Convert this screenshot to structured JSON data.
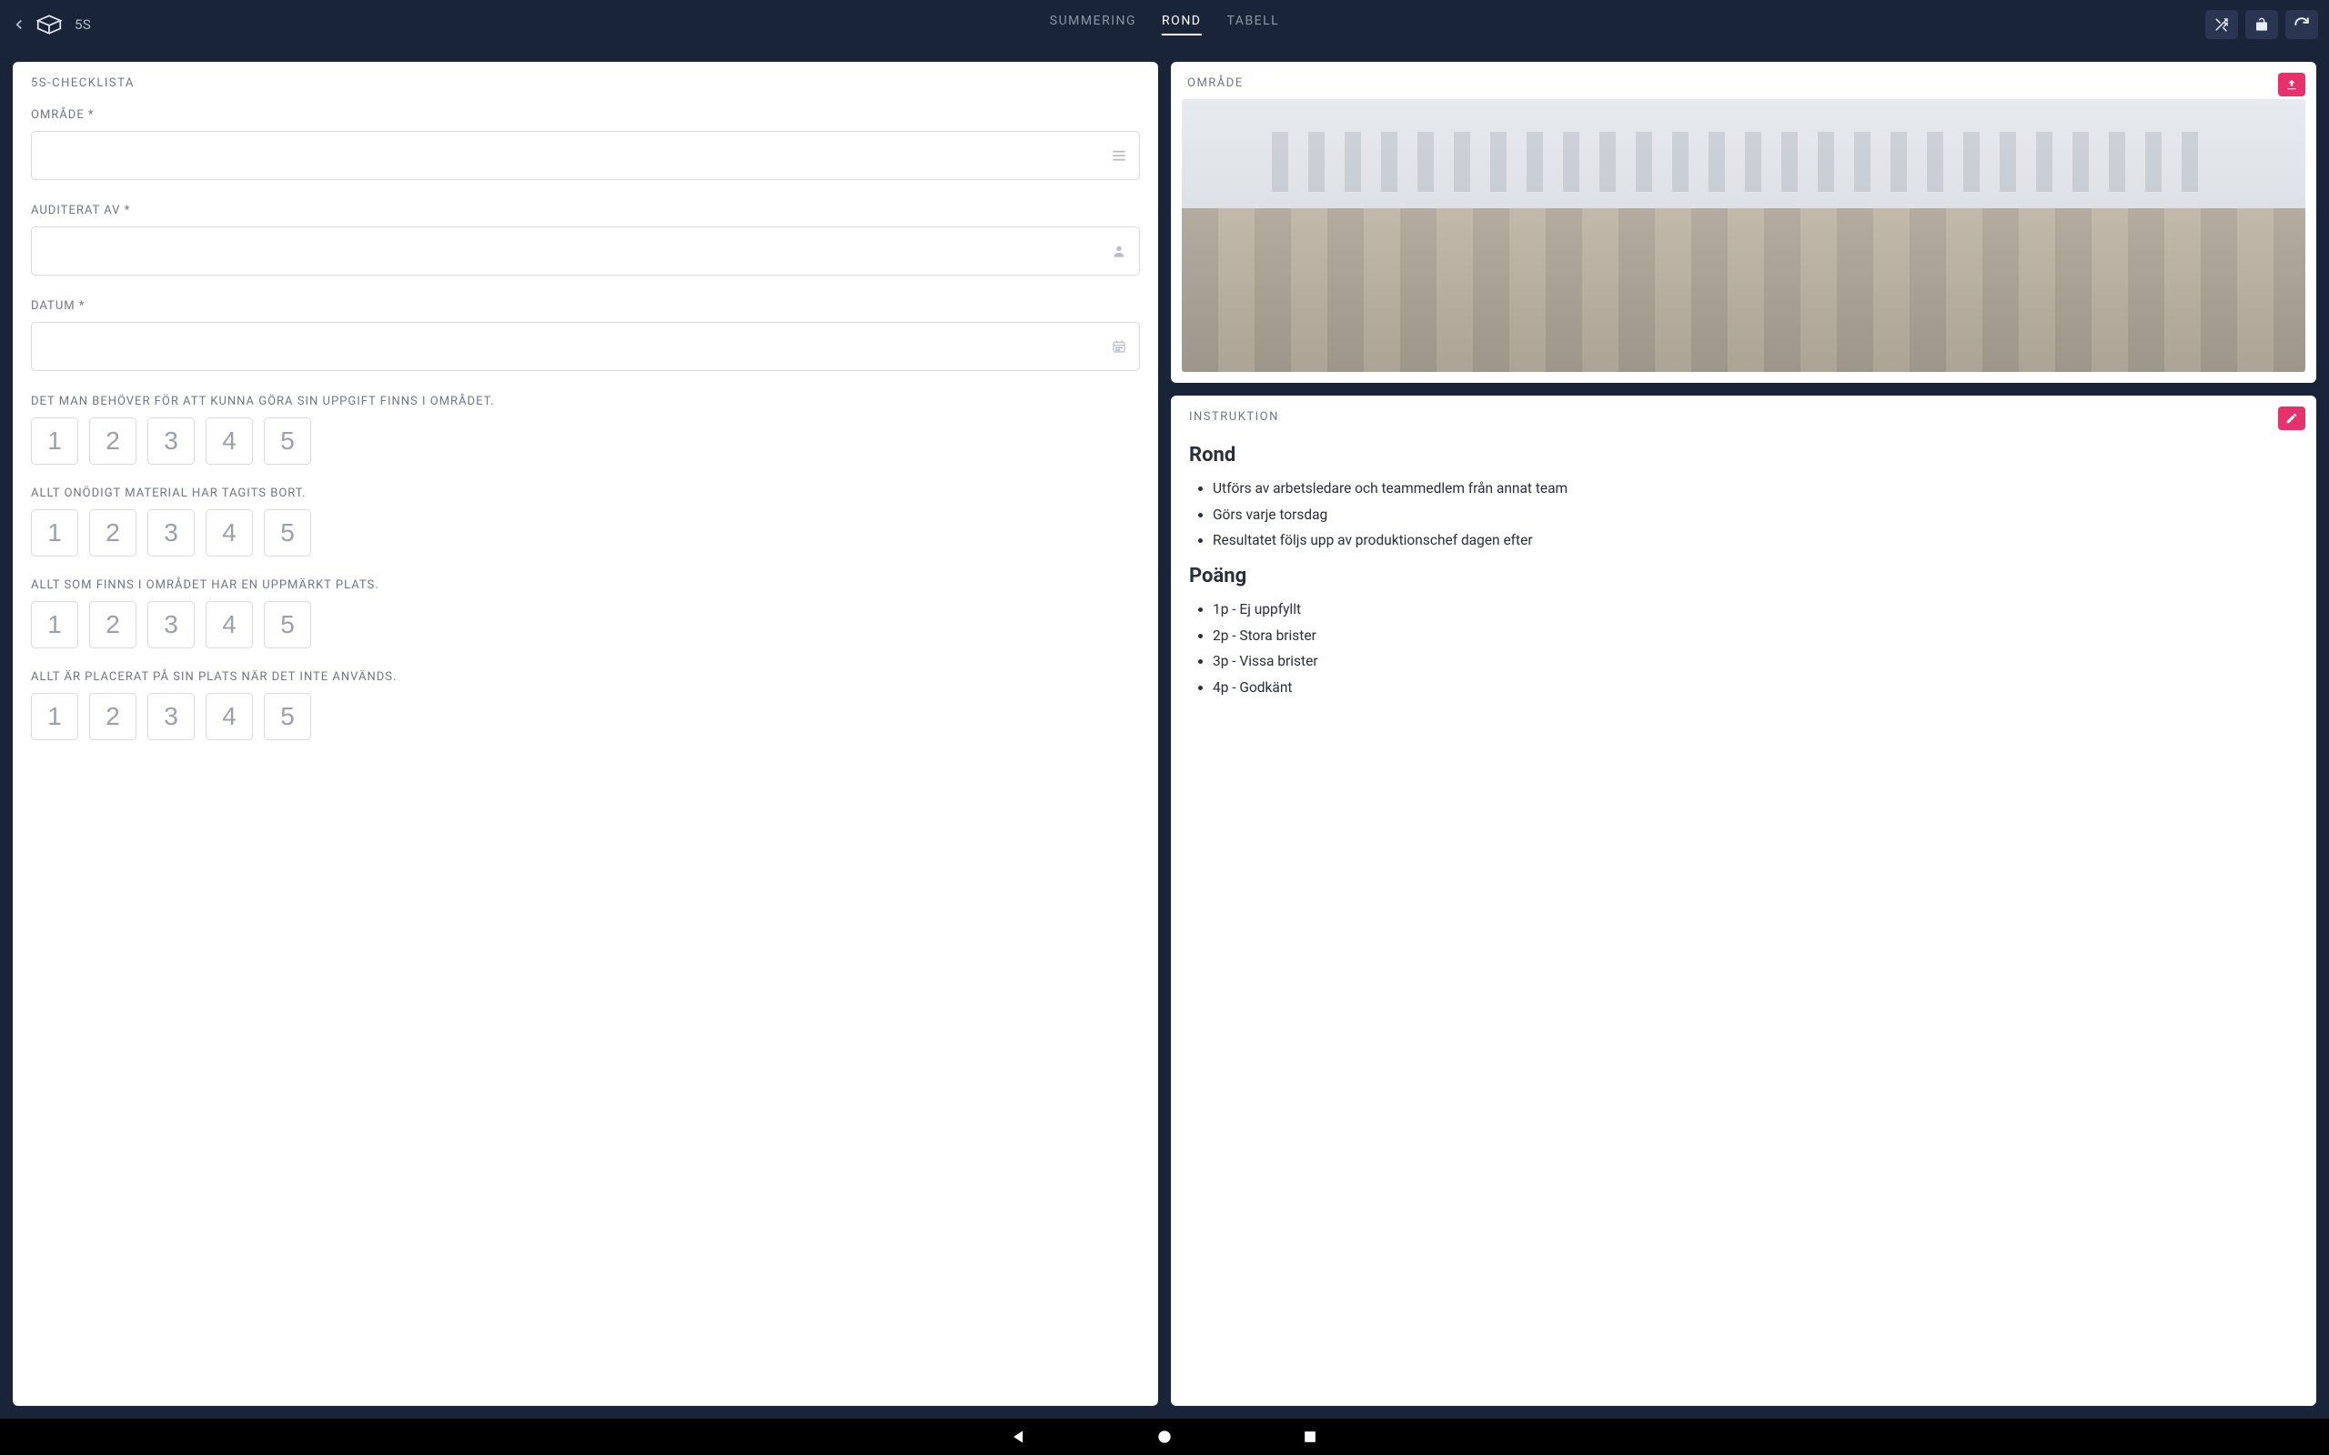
{
  "header": {
    "title": "5S",
    "tabs": [
      {
        "label": "SUMMERING",
        "active": false
      },
      {
        "label": "ROND",
        "active": true
      },
      {
        "label": "TABELL",
        "active": false
      }
    ]
  },
  "checklist": {
    "card_title": "5S-CHECKLISTA",
    "fields": {
      "area_label": "OMRÅDE *",
      "audited_by_label": "AUDITERAT AV *",
      "date_label": "DATUM *"
    },
    "rating_scale": [
      "1",
      "2",
      "3",
      "4",
      "5"
    ],
    "questions": [
      "DET MAN BEHÖVER FÖR ATT KUNNA GÖRA SIN UPPGIFT FINNS I OMRÅDET.",
      "ALLT ONÖDIGT MATERIAL HAR TAGITS BORT.",
      "ALLT SOM FINNS I OMRÅDET HAR EN UPPMÄRKT PLATS.",
      "ALLT ÄR PLACERAT PÅ SIN PLATS NÄR DET INTE ANVÄNDS."
    ]
  },
  "area": {
    "card_title": "OMRÅDE"
  },
  "instruction": {
    "card_title": "INSTRUKTION",
    "sections": [
      {
        "heading": "Rond",
        "items": [
          "Utförs av arbetsledare och teammedlem från annat team",
          "Görs varje torsdag",
          "Resultatet följs upp av produktionschef dagen efter"
        ]
      },
      {
        "heading": "Poäng",
        "items": [
          "1p - Ej uppfyllt",
          "2p - Stora brister",
          "3p - Vissa brister",
          "4p - Godkänt"
        ]
      }
    ]
  },
  "colors": {
    "accent": "#e5316c",
    "bg": "#1a2438",
    "panel": "#ffffff"
  }
}
